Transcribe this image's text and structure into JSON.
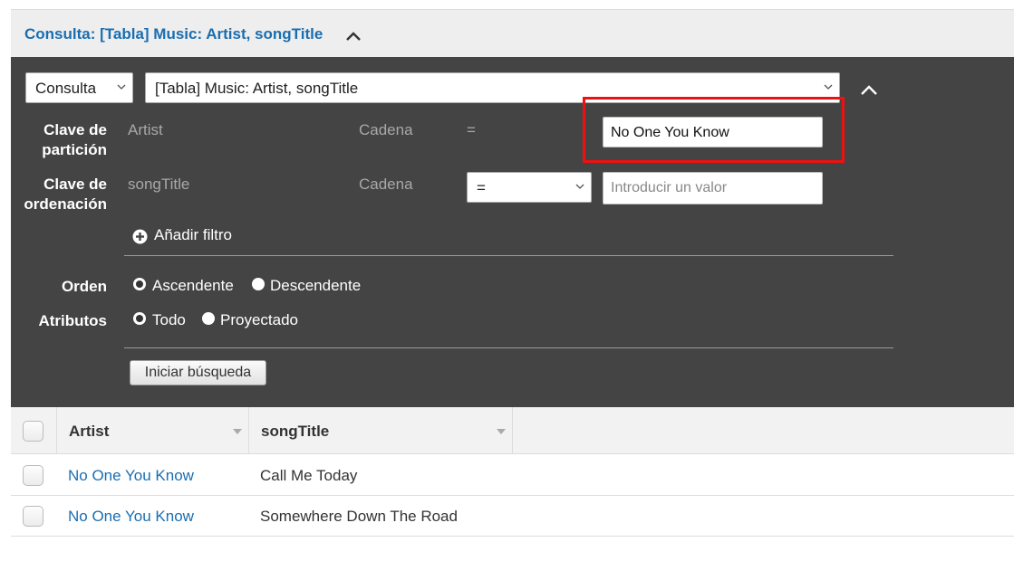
{
  "header": {
    "title": "Consulta: [Tabla] Music: Artist, songTitle"
  },
  "query": {
    "mode_value": "Consulta",
    "index_value": "[Tabla] Music: Artist, songTitle",
    "partition": {
      "label": "Clave de partición",
      "attribute": "Artist",
      "type": "Cadena",
      "operator": "=",
      "value": "No One You Know"
    },
    "sort": {
      "label": "Clave de ordenación",
      "attribute": "songTitle",
      "type": "Cadena",
      "operator_value": "=",
      "placeholder": "Introducir un valor"
    },
    "add_filter_label": "Añadir filtro",
    "order": {
      "label": "Orden",
      "options": [
        {
          "label": "Ascendente",
          "checked": true
        },
        {
          "label": "Descendente",
          "checked": false
        }
      ]
    },
    "attributes": {
      "label": "Atributos",
      "options": [
        {
          "label": "Todo",
          "checked": true
        },
        {
          "label": "Proyectado",
          "checked": false
        }
      ]
    },
    "search_button": "Iniciar búsqueda"
  },
  "table": {
    "columns": [
      "Artist",
      "songTitle"
    ],
    "rows": [
      {
        "artist": "No One You Know",
        "song": "Call Me Today"
      },
      {
        "artist": "No One You Know",
        "song": "Somewhere Down The Road"
      }
    ]
  },
  "colors": {
    "accent_link": "#1a6eb0",
    "panel_dark": "#444444",
    "highlight": "#ee1111"
  }
}
